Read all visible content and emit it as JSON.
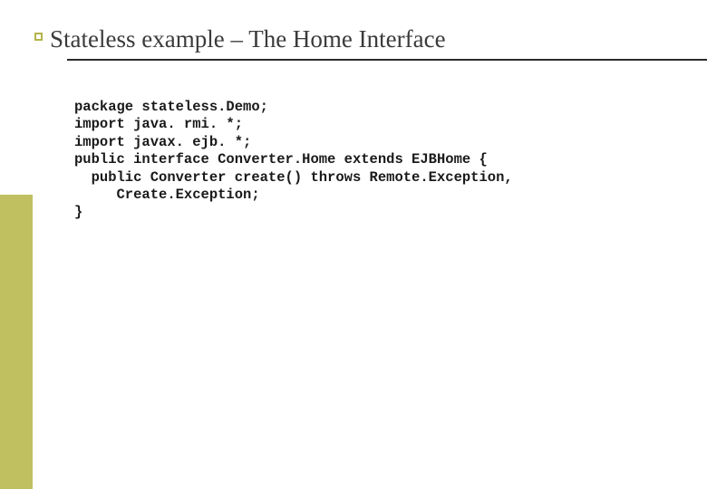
{
  "title": "Stateless example – The Home Interface",
  "code": {
    "l1": "package stateless.Demo;",
    "l2": "import java. rmi. *;",
    "l3": "import javax. ejb. *;",
    "l4": "",
    "l5": "public interface Converter.Home extends EJBHome {",
    "l6": "  public Converter create() throws Remote.Exception,",
    "l7": "     Create.Exception;",
    "l8": "}"
  }
}
